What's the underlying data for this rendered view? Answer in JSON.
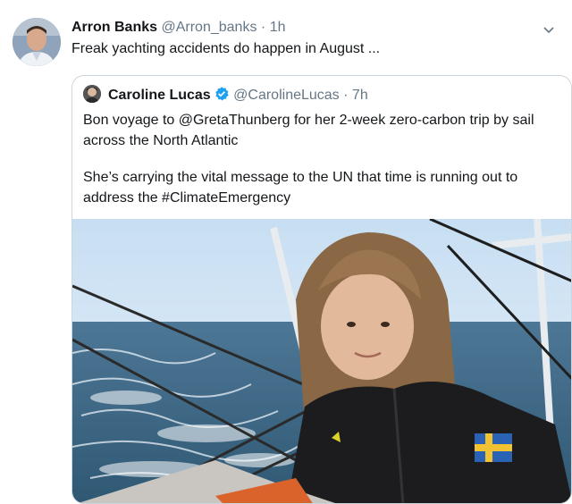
{
  "tweet": {
    "author_name": "Arron Banks",
    "author_handle": "@Arron_banks",
    "separator": "·",
    "time": "1h",
    "text": "Freak yachting accidents do happen in August ...",
    "avatar_icon": "user-avatar",
    "menu_icon": "chevron-down-icon"
  },
  "quoted": {
    "author_name": "Caroline Lucas",
    "verified_icon": "verified-badge-icon",
    "author_handle": "@CarolineLucas",
    "separator": "·",
    "time": "7h",
    "paragraph1": "Bon voyage to @GretaThunberg for her 2-week zero-carbon trip by sail across the North Atlantic",
    "paragraph2": "She’s carrying the vital message to the UN that time is running out to address the #ClimateEmergency",
    "image_icon": "photo-sailing-girl"
  },
  "colors": {
    "text_primary": "#14171a",
    "text_secondary": "#657786",
    "border": "#ccd6dd",
    "verified_blue": "#1da1f2"
  }
}
